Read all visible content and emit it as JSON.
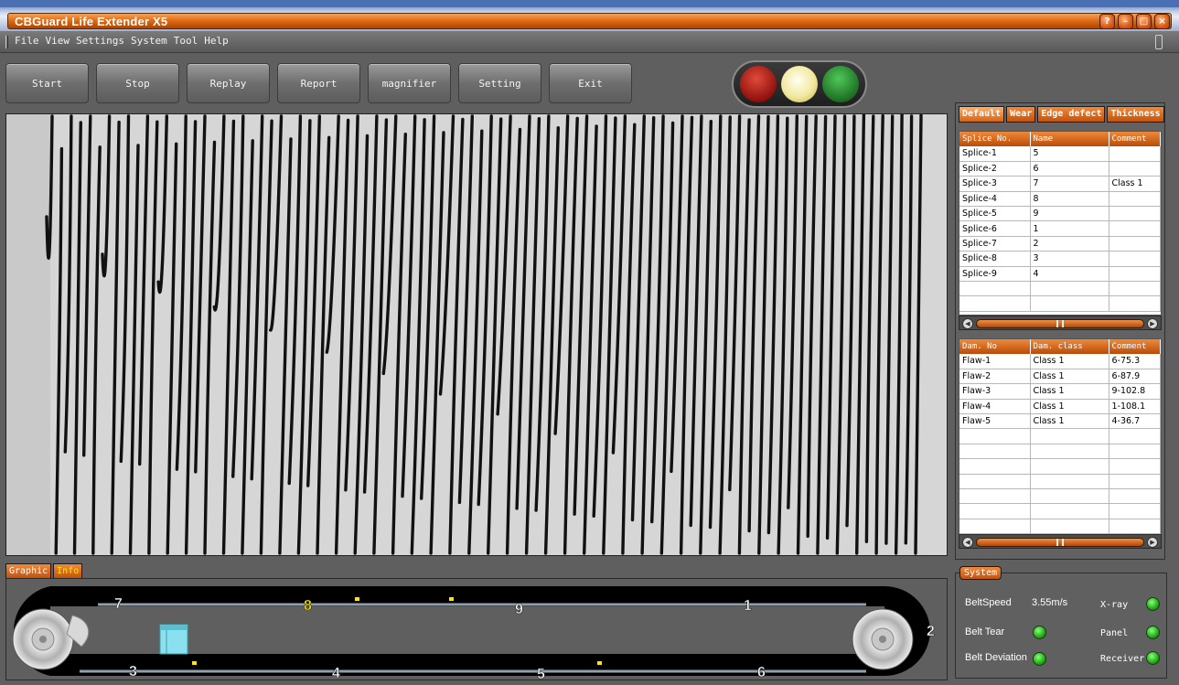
{
  "window": {
    "title": "CBGuard Life Extender X5"
  },
  "window_buttons": [
    "?",
    "–",
    "□",
    "×"
  ],
  "menu": [
    "File",
    "View",
    "Settings",
    "System",
    "Tool",
    "Help"
  ],
  "toolbar": [
    "Start",
    "Stop",
    "Replay",
    "Report",
    "magnifier",
    "Setting",
    "Exit"
  ],
  "right_tabs": [
    "Default",
    "Wear",
    "Edge defect",
    "Thickness"
  ],
  "splice_table": {
    "headers": [
      "Splice No.",
      "Name",
      "Comment"
    ],
    "rows": [
      [
        "Splice-1",
        "5",
        ""
      ],
      [
        "Splice-2",
        "6",
        ""
      ],
      [
        "Splice-3",
        "7",
        "Class 1"
      ],
      [
        "Splice-4",
        "8",
        ""
      ],
      [
        "Splice-5",
        "9",
        ""
      ],
      [
        "Splice-6",
        "1",
        ""
      ],
      [
        "Splice-7",
        "2",
        ""
      ],
      [
        "Splice-8",
        "3",
        ""
      ],
      [
        "Splice-9",
        "4",
        ""
      ]
    ]
  },
  "damage_table": {
    "headers": [
      "Dam. No",
      "Dam. class",
      "Comment"
    ],
    "rows": [
      [
        "Flaw-1",
        "Class 1",
        "6-75.3"
      ],
      [
        "Flaw-2",
        "Class 1",
        "6-87.9"
      ],
      [
        "Flaw-3",
        "Class 1",
        "9-102.8"
      ],
      [
        "Flaw-4",
        "Class 1",
        "1-108.1"
      ],
      [
        "Flaw-5",
        "Class 1",
        "4-36.7"
      ]
    ]
  },
  "bottom_tabs": [
    "Graphic",
    "Info"
  ],
  "belt": {
    "top_labels": [
      "7",
      "8",
      "9",
      "1"
    ],
    "right_label": "2",
    "bottom_labels": [
      "3",
      "4",
      "5",
      "6"
    ],
    "highlighted": "8"
  },
  "system": {
    "title": "System",
    "belt_speed_label": "BeltSpeed",
    "belt_speed_value": "3.55m/s",
    "belt_tear": "Belt Tear",
    "belt_deviation": "Belt Deviation",
    "xray": "X-ray",
    "panel": "Panel",
    "receiver": "Receiver",
    "status_color": "#27b21e"
  },
  "colors": {
    "accent": "#d9640f",
    "traffic_red": "#b51a14",
    "traffic_yellow": "#f2e8a0",
    "traffic_green": "#2f8a35"
  }
}
